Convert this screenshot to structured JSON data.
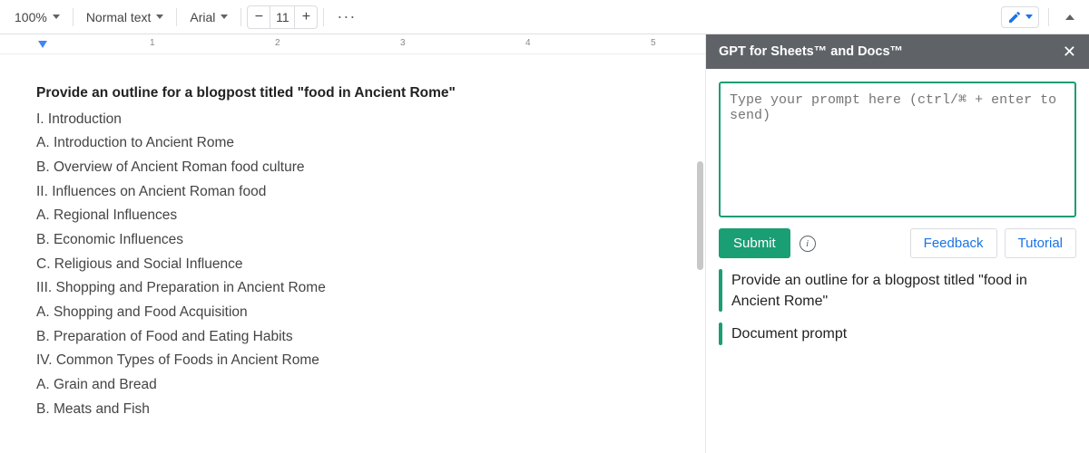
{
  "toolbar": {
    "zoom": "100%",
    "style": "Normal text",
    "font": "Arial",
    "font_size": "11",
    "minus": "−",
    "plus": "+",
    "more": "···"
  },
  "ruler": {
    "marks": [
      "1",
      "2",
      "3",
      "4",
      "5"
    ]
  },
  "document": {
    "title": "Provide an outline for a blogpost titled \"food in Ancient Rome\"",
    "lines": [
      "I. Introduction",
      "A. Introduction to Ancient Rome",
      "B. Overview of Ancient Roman food culture",
      "II. Influences on Ancient Roman food",
      "A. Regional Influences",
      "B. Economic Influences",
      "C. Religious and Social Influence",
      "III. Shopping and Preparation in Ancient Rome",
      "A. Shopping and Food Acquisition",
      "B. Preparation of Food and Eating Habits",
      "IV. Common Types of Foods in Ancient Rome",
      "A. Grain and Bread",
      "B. Meats and Fish"
    ]
  },
  "sidebar": {
    "title": "GPT for Sheets™ and Docs™",
    "close": "✕",
    "prompt_placeholder": "Type your prompt here (ctrl/⌘ + enter to send)",
    "submit": "Submit",
    "feedback": "Feedback",
    "tutorial": "Tutorial",
    "history": [
      "Provide an outline for a blogpost titled \"food in Ancient Rome\"",
      "Document prompt"
    ]
  }
}
